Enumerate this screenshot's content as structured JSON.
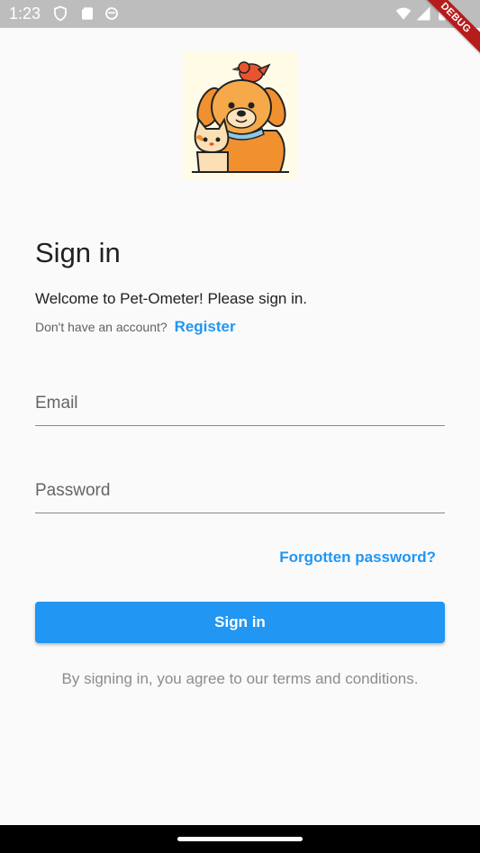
{
  "status_bar": {
    "time": "1:23",
    "debug_label": "DEBUG"
  },
  "page": {
    "title": "Sign in",
    "welcome": "Welcome to Pet-Ometer! Please sign in.",
    "no_account": "Don't have an account?",
    "register_label": "Register"
  },
  "form": {
    "email_placeholder": "Email",
    "password_placeholder": "Password",
    "forgot_label": "Forgotten password?",
    "signin_label": "Sign in"
  },
  "terms": "By signing in, you agree to our terms and conditions.",
  "colors": {
    "accent": "#2196f3",
    "status_bar": "#bdbdbd",
    "debug_banner": "#b71c1c"
  },
  "icons": [
    "shield-icon",
    "sd-card-icon",
    "sync-icon",
    "wifi-icon",
    "signal-icon",
    "battery-icon"
  ]
}
